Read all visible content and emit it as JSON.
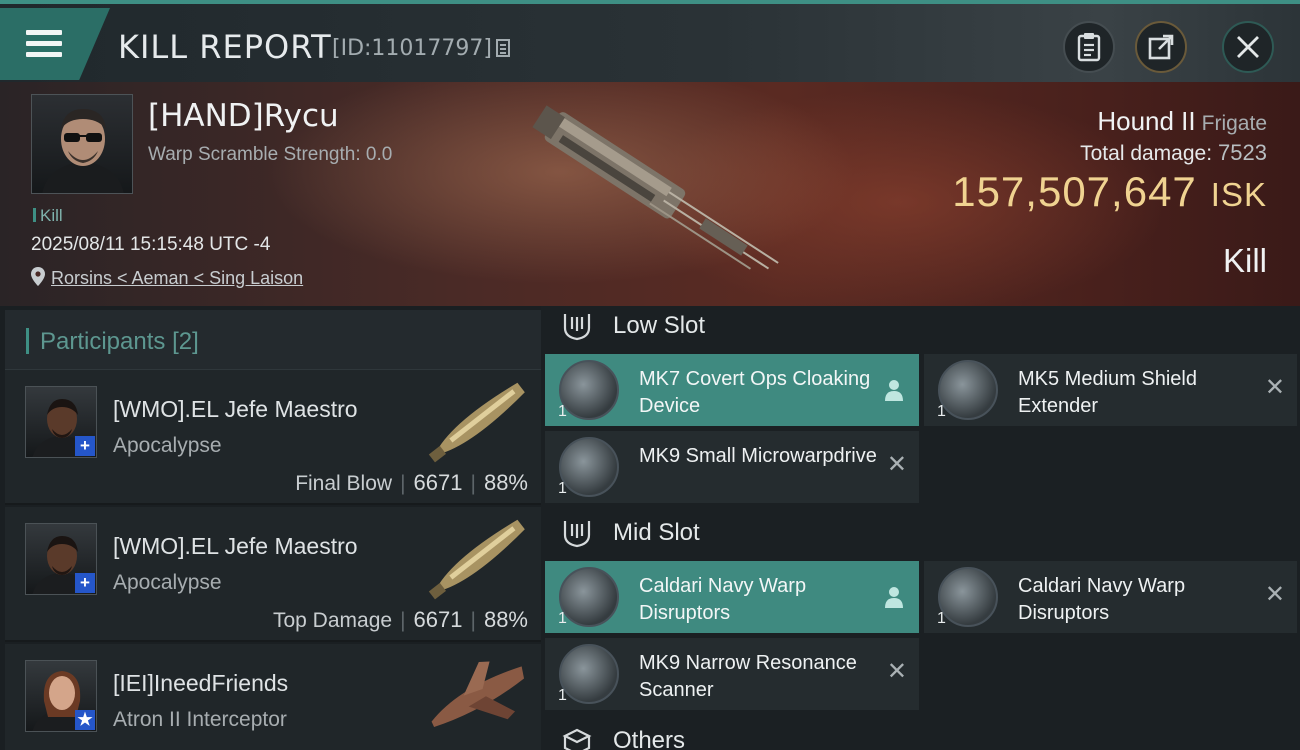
{
  "header": {
    "title": "KILL REPORT",
    "report_id": "[ID:11017797]"
  },
  "victim": {
    "name": "[HAND]Rycu",
    "scramble": "Warp Scramble Strength: 0.0",
    "kill_label": "Kill",
    "datetime": "2025/08/11 15:15:48 UTC -4",
    "location": "Rorsins < Aeman < Sing Laison",
    "ship": "Hound II",
    "ship_class": "Frigate",
    "total_damage_label": "Total damage:",
    "total_damage": "7523",
    "isk_value": "157,507,647",
    "isk_unit": "ISK",
    "result": "Kill"
  },
  "participants": {
    "title": "Participants",
    "count": "[2]",
    "rows": [
      {
        "name": "[WMO].EL Jefe Maestro",
        "ship": "Apocalypse",
        "role": "Final Blow",
        "damage": "6671",
        "percent": "88%",
        "badge": "+"
      },
      {
        "name": "[WMO].EL Jefe Maestro",
        "ship": "Apocalypse",
        "role": "Top Damage",
        "damage": "6671",
        "percent": "88%",
        "badge": "+"
      },
      {
        "name": "[IEI]IneedFriends",
        "ship": "Atron II Interceptor",
        "role": "",
        "damage": "",
        "percent": "",
        "badge": "★"
      }
    ]
  },
  "slots": {
    "low": {
      "title": "Low Slot",
      "modules": [
        {
          "name": "MK7 Covert Ops Cloaking Device",
          "qty": "1"
        },
        {
          "name": "MK5 Medium Shield Extender",
          "qty": "1"
        },
        {
          "name": "MK9 Small Microwarpdrive",
          "qty": "1"
        }
      ]
    },
    "mid": {
      "title": "Mid Slot",
      "modules": [
        {
          "name": "Caldari Navy Warp Disruptors",
          "qty": "1"
        },
        {
          "name": "Caldari Navy Warp Disruptors",
          "qty": "1"
        },
        {
          "name": "MK9 Narrow Resonance Scanner",
          "qty": "1"
        }
      ]
    },
    "others": {
      "title": "Others"
    }
  },
  "colors": {
    "accent": "#3e8f84",
    "isk_gold": "#f0d391",
    "participants_title": "#5d9790"
  }
}
